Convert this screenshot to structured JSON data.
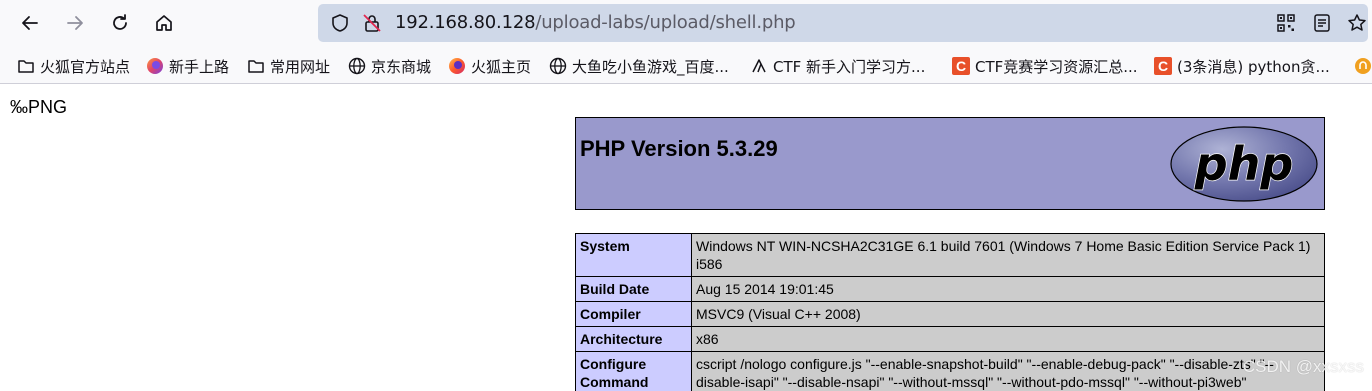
{
  "browser": {
    "url_host": "192.168.80.128",
    "url_path": "/upload-labs/upload/shell.php"
  },
  "bookmarks": [
    {
      "label": "火狐官方站点",
      "icon": "folder-icon"
    },
    {
      "label": "新手上路",
      "icon": "firefox-icon"
    },
    {
      "label": "常用网址",
      "icon": "folder-icon"
    },
    {
      "label": "京东商城",
      "icon": "globe-icon"
    },
    {
      "label": "火狐主页",
      "icon": "firefox-icon"
    },
    {
      "label": "大鱼吃小鱼游戏_百度...",
      "icon": "globe-icon"
    },
    {
      "label": "CTF 新手入门学习方...",
      "icon": "ctf-icon"
    },
    {
      "label": "CTF竞赛学习资源汇总...",
      "icon": "csdn-c-icon"
    },
    {
      "label": "(3条消息) python贪...",
      "icon": "csdn-c-icon"
    }
  ],
  "page": {
    "top_text": "‰PNG",
    "php_version_title": "PHP Version 5.3.29",
    "rows": [
      {
        "key": "System",
        "value": "Windows NT WIN-NCSHA2C31GE 6.1 build 7601 (Windows 7 Home Basic Edition Service Pack 1) i586"
      },
      {
        "key": "Build Date",
        "value": "Aug 15 2014 19:01:45"
      },
      {
        "key": "Compiler",
        "value": "MSVC9 (Visual C++ 2008)"
      },
      {
        "key": "Architecture",
        "value": "x86"
      },
      {
        "key": "Configure Command",
        "value": "cscript /nologo configure.js \"--enable-snapshot-build\" \"--enable-debug-pack\" \"--disable-zts\" \"--disable-isapi\" \"--disable-nsapi\" \"--without-mssql\" \"--without-pdo-mssql\" \"--without-pi3web\""
      }
    ],
    "watermark": "CSDN @xxsxss"
  },
  "colors": {
    "php_header_bg": "#9999cc",
    "key_cell_bg": "#ccccff",
    "value_cell_bg": "#cccccc",
    "url_bar_bg": "#cfd8e8"
  }
}
